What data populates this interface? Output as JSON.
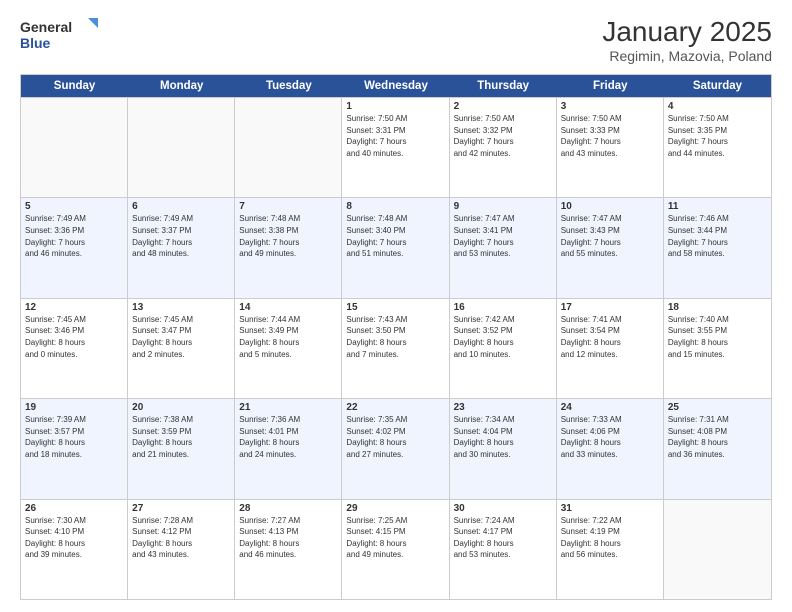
{
  "header": {
    "logo_line1": "General",
    "logo_line2": "Blue",
    "title": "January 2025",
    "subtitle": "Regimin, Mazovia, Poland"
  },
  "days": [
    "Sunday",
    "Monday",
    "Tuesday",
    "Wednesday",
    "Thursday",
    "Friday",
    "Saturday"
  ],
  "weeks": [
    [
      {
        "day": "",
        "content": ""
      },
      {
        "day": "",
        "content": ""
      },
      {
        "day": "",
        "content": ""
      },
      {
        "day": "1",
        "content": "Sunrise: 7:50 AM\nSunset: 3:31 PM\nDaylight: 7 hours\nand 40 minutes."
      },
      {
        "day": "2",
        "content": "Sunrise: 7:50 AM\nSunset: 3:32 PM\nDaylight: 7 hours\nand 42 minutes."
      },
      {
        "day": "3",
        "content": "Sunrise: 7:50 AM\nSunset: 3:33 PM\nDaylight: 7 hours\nand 43 minutes."
      },
      {
        "day": "4",
        "content": "Sunrise: 7:50 AM\nSunset: 3:35 PM\nDaylight: 7 hours\nand 44 minutes."
      }
    ],
    [
      {
        "day": "5",
        "content": "Sunrise: 7:49 AM\nSunset: 3:36 PM\nDaylight: 7 hours\nand 46 minutes."
      },
      {
        "day": "6",
        "content": "Sunrise: 7:49 AM\nSunset: 3:37 PM\nDaylight: 7 hours\nand 48 minutes."
      },
      {
        "day": "7",
        "content": "Sunrise: 7:48 AM\nSunset: 3:38 PM\nDaylight: 7 hours\nand 49 minutes."
      },
      {
        "day": "8",
        "content": "Sunrise: 7:48 AM\nSunset: 3:40 PM\nDaylight: 7 hours\nand 51 minutes."
      },
      {
        "day": "9",
        "content": "Sunrise: 7:47 AM\nSunset: 3:41 PM\nDaylight: 7 hours\nand 53 minutes."
      },
      {
        "day": "10",
        "content": "Sunrise: 7:47 AM\nSunset: 3:43 PM\nDaylight: 7 hours\nand 55 minutes."
      },
      {
        "day": "11",
        "content": "Sunrise: 7:46 AM\nSunset: 3:44 PM\nDaylight: 7 hours\nand 58 minutes."
      }
    ],
    [
      {
        "day": "12",
        "content": "Sunrise: 7:45 AM\nSunset: 3:46 PM\nDaylight: 8 hours\nand 0 minutes."
      },
      {
        "day": "13",
        "content": "Sunrise: 7:45 AM\nSunset: 3:47 PM\nDaylight: 8 hours\nand 2 minutes."
      },
      {
        "day": "14",
        "content": "Sunrise: 7:44 AM\nSunset: 3:49 PM\nDaylight: 8 hours\nand 5 minutes."
      },
      {
        "day": "15",
        "content": "Sunrise: 7:43 AM\nSunset: 3:50 PM\nDaylight: 8 hours\nand 7 minutes."
      },
      {
        "day": "16",
        "content": "Sunrise: 7:42 AM\nSunset: 3:52 PM\nDaylight: 8 hours\nand 10 minutes."
      },
      {
        "day": "17",
        "content": "Sunrise: 7:41 AM\nSunset: 3:54 PM\nDaylight: 8 hours\nand 12 minutes."
      },
      {
        "day": "18",
        "content": "Sunrise: 7:40 AM\nSunset: 3:55 PM\nDaylight: 8 hours\nand 15 minutes."
      }
    ],
    [
      {
        "day": "19",
        "content": "Sunrise: 7:39 AM\nSunset: 3:57 PM\nDaylight: 8 hours\nand 18 minutes."
      },
      {
        "day": "20",
        "content": "Sunrise: 7:38 AM\nSunset: 3:59 PM\nDaylight: 8 hours\nand 21 minutes."
      },
      {
        "day": "21",
        "content": "Sunrise: 7:36 AM\nSunset: 4:01 PM\nDaylight: 8 hours\nand 24 minutes."
      },
      {
        "day": "22",
        "content": "Sunrise: 7:35 AM\nSunset: 4:02 PM\nDaylight: 8 hours\nand 27 minutes."
      },
      {
        "day": "23",
        "content": "Sunrise: 7:34 AM\nSunset: 4:04 PM\nDaylight: 8 hours\nand 30 minutes."
      },
      {
        "day": "24",
        "content": "Sunrise: 7:33 AM\nSunset: 4:06 PM\nDaylight: 8 hours\nand 33 minutes."
      },
      {
        "day": "25",
        "content": "Sunrise: 7:31 AM\nSunset: 4:08 PM\nDaylight: 8 hours\nand 36 minutes."
      }
    ],
    [
      {
        "day": "26",
        "content": "Sunrise: 7:30 AM\nSunset: 4:10 PM\nDaylight: 8 hours\nand 39 minutes."
      },
      {
        "day": "27",
        "content": "Sunrise: 7:28 AM\nSunset: 4:12 PM\nDaylight: 8 hours\nand 43 minutes."
      },
      {
        "day": "28",
        "content": "Sunrise: 7:27 AM\nSunset: 4:13 PM\nDaylight: 8 hours\nand 46 minutes."
      },
      {
        "day": "29",
        "content": "Sunrise: 7:25 AM\nSunset: 4:15 PM\nDaylight: 8 hours\nand 49 minutes."
      },
      {
        "day": "30",
        "content": "Sunrise: 7:24 AM\nSunset: 4:17 PM\nDaylight: 8 hours\nand 53 minutes."
      },
      {
        "day": "31",
        "content": "Sunrise: 7:22 AM\nSunset: 4:19 PM\nDaylight: 8 hours\nand 56 minutes."
      },
      {
        "day": "",
        "content": ""
      }
    ]
  ]
}
